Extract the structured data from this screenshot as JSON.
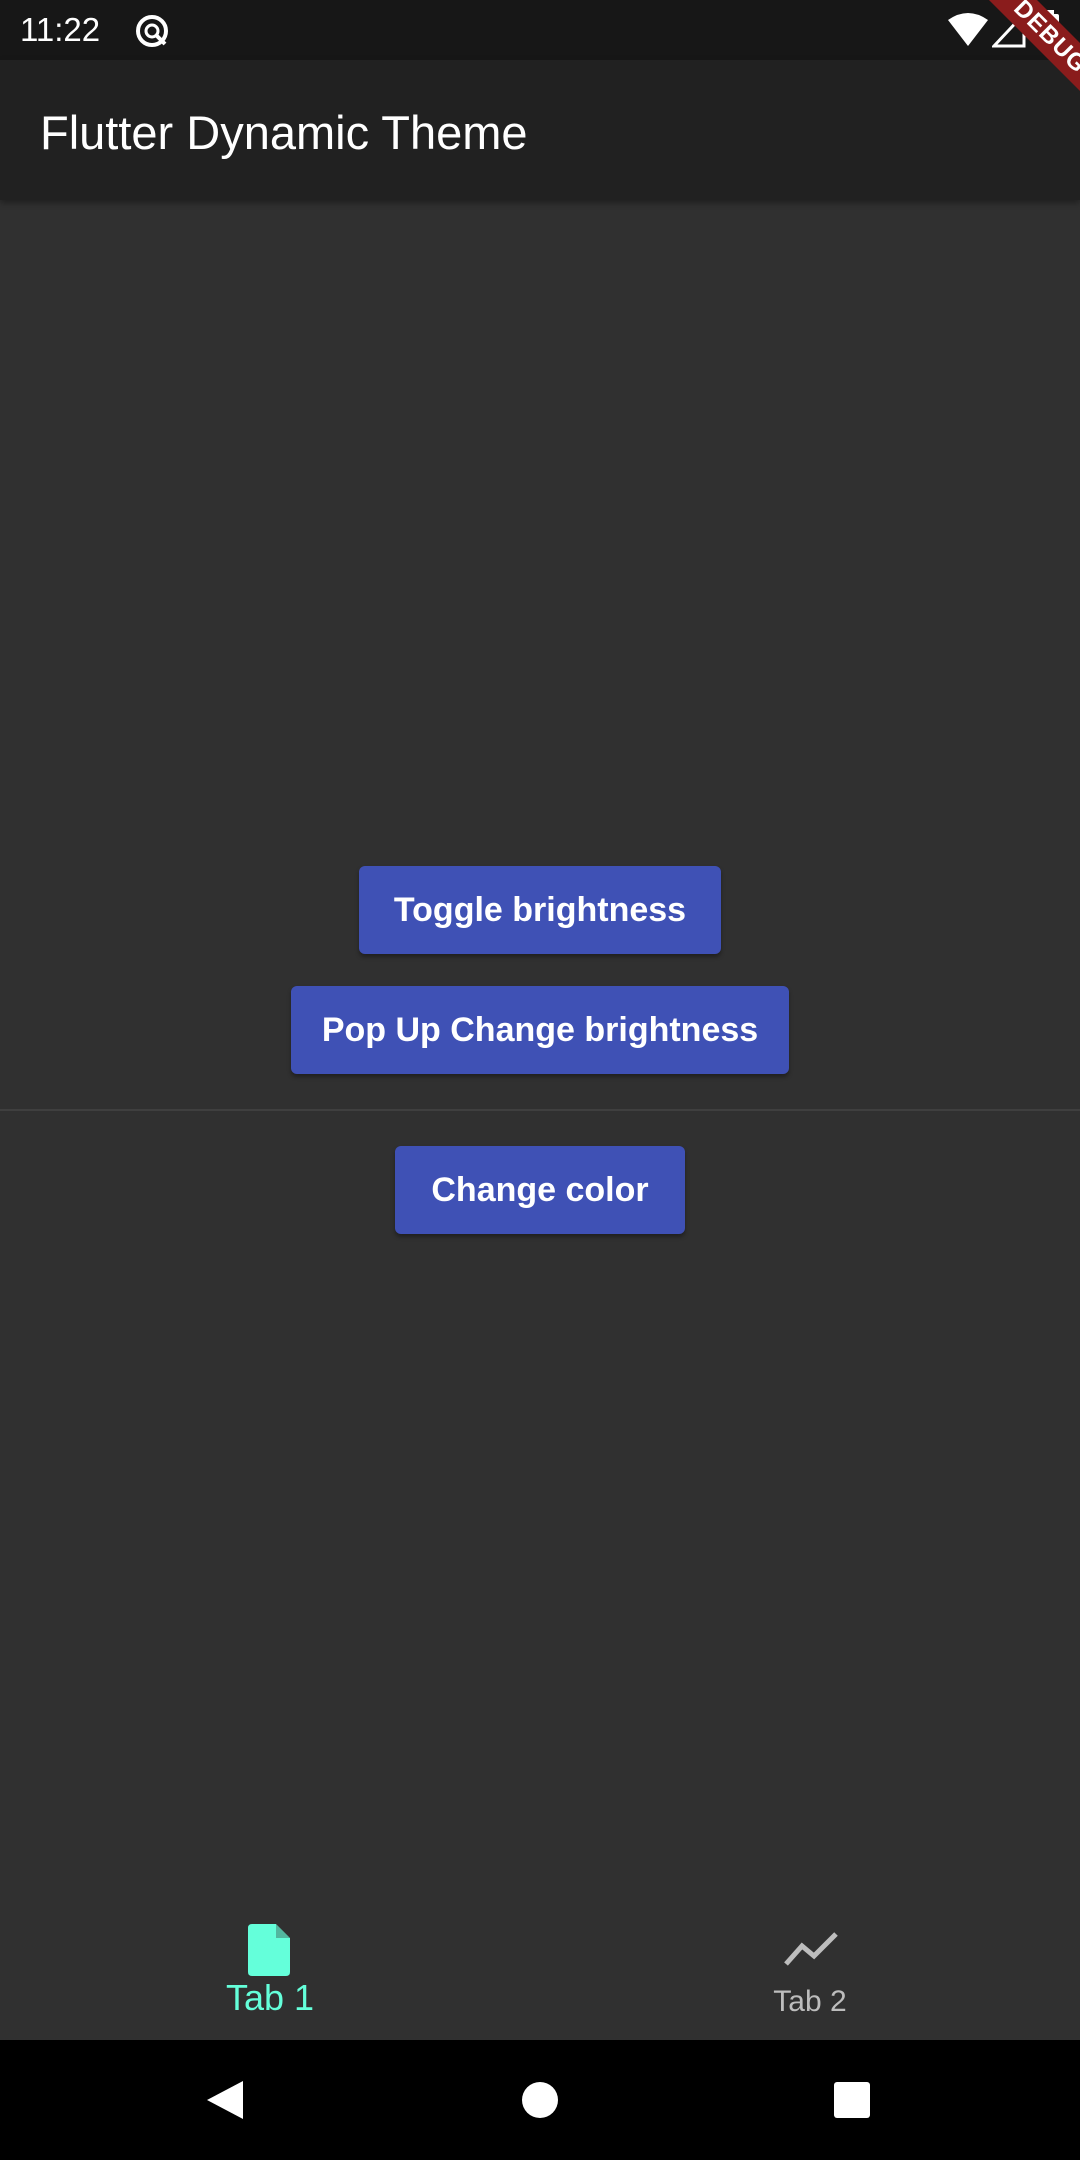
{
  "status_bar": {
    "time": "11:22",
    "icons": [
      "sync-icon",
      "wifi-icon",
      "cell-signal-icon",
      "battery-icon"
    ]
  },
  "debug_banner": "DEBUG",
  "app_bar": {
    "title": "Flutter Dynamic Theme"
  },
  "main": {
    "toggle_button": "Toggle brightness",
    "popup_button": "Pop Up Change brightness",
    "color_button": "Change color"
  },
  "bottom_nav": {
    "tabs": [
      {
        "label": "Tab 1",
        "icon": "document-icon",
        "selected": true
      },
      {
        "label": "Tab 2",
        "icon": "trending-icon",
        "selected": false
      }
    ]
  },
  "system_nav": {
    "buttons": [
      "back-icon",
      "home-icon",
      "recents-icon"
    ]
  },
  "colors": {
    "background": "#303030",
    "app_bar": "#212121",
    "status_bar": "#171717",
    "button": "#3f51b5",
    "selected_tab": "#64ffda",
    "unselected_tab": "#bdbdbd",
    "debug_ribbon": "#8a1c1c"
  }
}
